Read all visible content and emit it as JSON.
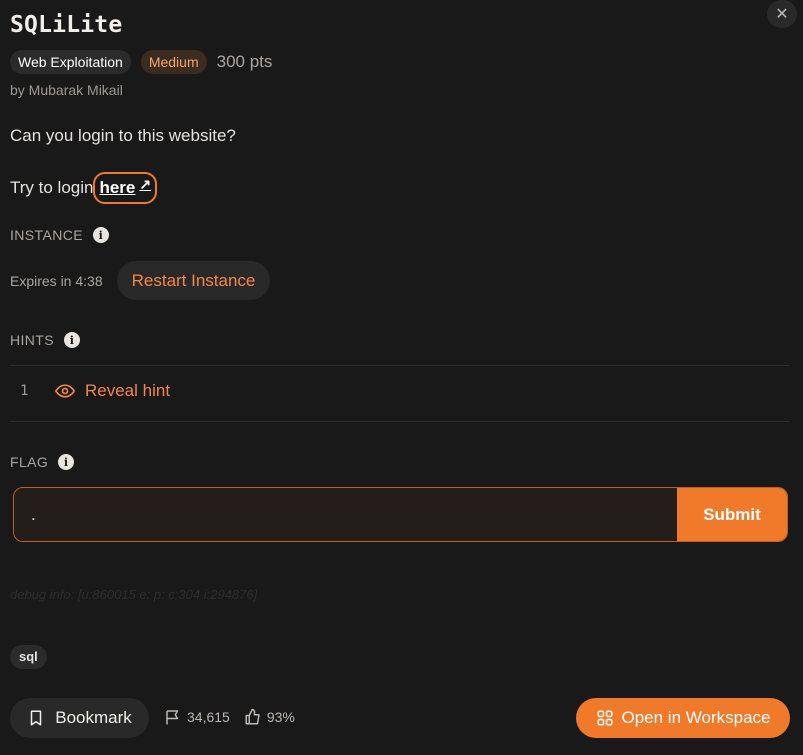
{
  "challenge": {
    "title": "SQLiLite",
    "category": "Web Exploitation",
    "difficulty": "Medium",
    "points": "300 pts",
    "author": "by Mubarak Mikail",
    "description": "Can you login to this website?",
    "login_prefix": "Try to login",
    "login_link": "here"
  },
  "instance": {
    "label": "INSTANCE",
    "expires": "Expires in 4:38",
    "restart_label": "Restart Instance"
  },
  "hints": {
    "label": "HINTS",
    "items": [
      {
        "number": "1",
        "reveal_label": "Reveal hint"
      }
    ]
  },
  "flag": {
    "label": "FLAG",
    "value": ".",
    "submit_label": "Submit"
  },
  "debug_info": "debug info: [u:860015 e: p: c:304 i:294876]",
  "tags": [
    "sql"
  ],
  "footer": {
    "bookmark_label": "Bookmark",
    "solves": "34,615",
    "rating": "93%",
    "workspace_label": "Open in Workspace"
  },
  "colors": {
    "accent": "#f07a2a",
    "background": "#1a191a",
    "difficulty_text": "#f4a86d"
  },
  "icons": {
    "close": "close-icon",
    "external_link": "external-link-icon",
    "info": "info-icon",
    "eye": "eye-icon",
    "bookmark": "bookmark-icon",
    "flag": "flag-icon",
    "thumbs_up": "thumbs-up-icon",
    "grid": "grid-icon"
  }
}
